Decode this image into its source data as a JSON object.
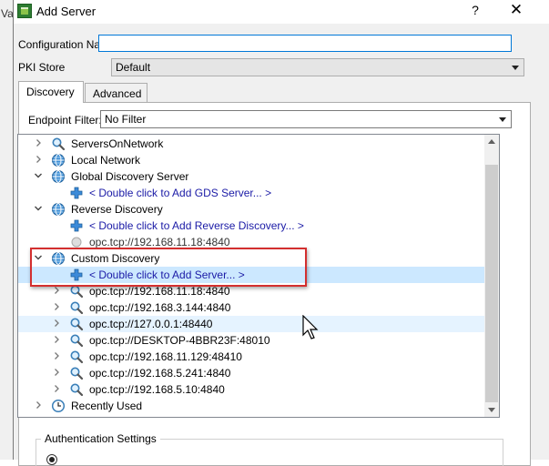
{
  "background_window": {
    "title_fragment": "Va"
  },
  "dialog": {
    "title": "Add Server",
    "help": "?",
    "close": "✕"
  },
  "form": {
    "config_name_label": "Configuration Name",
    "config_name_value": "",
    "pki_store_label": "PKI Store",
    "pki_store_value": "Default"
  },
  "tabs": [
    {
      "label": "Discovery",
      "active": true
    },
    {
      "label": "Advanced",
      "active": false
    }
  ],
  "discovery": {
    "endpoint_filter_label": "Endpoint Filter:",
    "endpoint_filter_value": "No Filter"
  },
  "tree": {
    "items": [
      {
        "label": "ServersOnNetwork",
        "icon": "search-icon",
        "expanded": false,
        "level": 0
      },
      {
        "label": "Local Network",
        "icon": "globe-icon",
        "expanded": false,
        "level": 0
      },
      {
        "label": "Global Discovery Server",
        "icon": "globe-icon",
        "expanded": true,
        "level": 0
      },
      {
        "label": "< Double click to Add GDS Server... >",
        "icon": "plus-icon",
        "level": 1,
        "link": true
      },
      {
        "label": "Reverse Discovery",
        "icon": "globe-icon",
        "expanded": true,
        "level": 0
      },
      {
        "label": "< Double click to Add Reverse Discovery... >",
        "icon": "plus-icon",
        "level": 1,
        "link": true
      },
      {
        "label": "opc.tcp://192.168.11.18:4840",
        "icon": "server-icon",
        "level": 1
      },
      {
        "label": "Custom Discovery",
        "icon": "globe-icon",
        "expanded": true,
        "level": 0
      },
      {
        "label": "< Double click to Add Server... >",
        "icon": "plus-icon",
        "level": 1,
        "link": true,
        "selected": true
      },
      {
        "label": "opc.tcp://192.168.11.18:4840",
        "icon": "search-icon",
        "expanded": false,
        "level": 1
      },
      {
        "label": "opc.tcp://192.168.3.144:4840",
        "icon": "search-icon",
        "expanded": false,
        "level": 1
      },
      {
        "label": "opc.tcp://127.0.0.1:48440",
        "icon": "search-icon",
        "expanded": false,
        "level": 1,
        "hover": true
      },
      {
        "label": "opc.tcp://DESKTOP-4BBR23F:48010",
        "icon": "search-icon",
        "expanded": false,
        "level": 1
      },
      {
        "label": "opc.tcp://192.168.11.129:48410",
        "icon": "search-icon",
        "expanded": false,
        "level": 1
      },
      {
        "label": "opc.tcp://192.168.5.241:4840",
        "icon": "search-icon",
        "expanded": false,
        "level": 1
      },
      {
        "label": "opc.tcp://192.168.5.10:4840",
        "icon": "search-icon",
        "expanded": false,
        "level": 1
      },
      {
        "label": "Recently Used",
        "icon": "clock-icon",
        "expanded": false,
        "level": 0
      }
    ]
  },
  "auth": {
    "group_title": "Authentication Settings"
  },
  "colors": {
    "highlight_box": "#d32f2f",
    "selection": "#cce8ff",
    "link": "#1a1aa6"
  }
}
